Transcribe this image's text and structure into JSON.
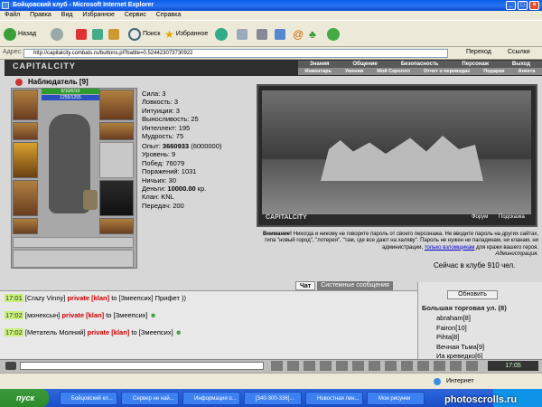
{
  "window": {
    "title": "Бойцовский клуб - Microsoft Internet Explorer"
  },
  "menu": [
    "Файл",
    "Правка",
    "Вид",
    "Избранное",
    "Сервис",
    "Справка"
  ],
  "toolbar": {
    "back": "Назад",
    "search": "Поиск",
    "favorites": "Избранное"
  },
  "address": {
    "label": "Адрес:",
    "url": "http://capitalcity.combats.ru/buttons.pl?battle=0.524423073730922",
    "go": "Переход",
    "links": "Ссылки"
  },
  "game": {
    "logo": "CAPITALCITY",
    "nav_top": [
      "Знания",
      "Общение",
      "Безопасность",
      "Персонаж",
      "Выход"
    ],
    "nav_bottom": [
      "Инвентарь",
      "Умения",
      "Мой Скроллл",
      "Отчет о переводах",
      "Подарки",
      "Анкета"
    ],
    "char_name": "Наблюдатель",
    "char_level": "[9]",
    "hp": "6/10/6/10",
    "mp": "1255/1255",
    "stats": [
      "Сила: 3",
      "Ловкость: 3",
      "Интуиция: 3",
      "Выносливость: 25",
      "Интеллект: 195",
      "Мудрость: 75"
    ],
    "exp_label": "Опыт:",
    "exp_value": "3660933",
    "exp_next": "(6000000)",
    "stats2": [
      "Уровень: 9",
      "Побед: 76079",
      "Поражений: 1031",
      "Ничьих: 30"
    ],
    "money_label": "Деньги:",
    "money_value": "10000.00",
    "money_unit": "кр.",
    "stats3": [
      "Клан: KNL",
      "Передач: 200"
    ],
    "scene_logo": "CAPITALCITY",
    "scene_links": [
      "Форум",
      "Подсказка"
    ],
    "warning_title": "Внимание!",
    "warning_text": "Никогда и никому не говорите пароль от своего персонажа. Не вводите пароль на других сайтах, типа \"новый город\", \"лотерея\", \"там, где все дают на халяву\". Пароль не нужен ни паладинам, ни кланам, ни администрации,",
    "warning_link": "только взломщикам",
    "warning_tail": "для кражи вашего героя.",
    "warning_sign": "Администрация.",
    "online": "Сейчас в клубе 910 чел.",
    "tabs": [
      "Чат",
      "Системные сообщения"
    ],
    "chat": [
      {
        "time": "17:01",
        "nick": "[Crazy Vinny]",
        "priv": "private [klan]",
        "to": "to [Змеепсих]",
        "msg": "Прифет ))"
      },
      {
        "time": "17:02",
        "nick": "[монексын]",
        "priv": "private [klan]",
        "to": "to [Змеепсих]",
        "msg": ""
      },
      {
        "time": "17:02",
        "nick": "[Метатель Молний]",
        "priv": "private [klan]",
        "to": "to [Змеепсих]",
        "msg": ""
      }
    ],
    "refresh": "Обновить",
    "street": "Большая торговая ул. (8)",
    "users": [
      "abraham[8]",
      "Fairon[10]",
      "Pihta[8]",
      "Вечная Тьма[9]",
      "Иа кревед­ко[6]"
    ]
  },
  "statusbar": {
    "zone": "Интернет"
  },
  "taskbar": {
    "start": "пуск",
    "tasks": [
      "Бойцовский кл...",
      "Сервер не най...",
      "Информация о...",
      "[340-300-336]...",
      "Новостная лен...",
      "Мои рисунки"
    ],
    "clock": "17:05"
  },
  "watermark": "photoscrolls.ru",
  "colors": {
    "chat_time": "#c9f07a",
    "private": "#cc0000",
    "xp_blue": "#245dd8"
  }
}
